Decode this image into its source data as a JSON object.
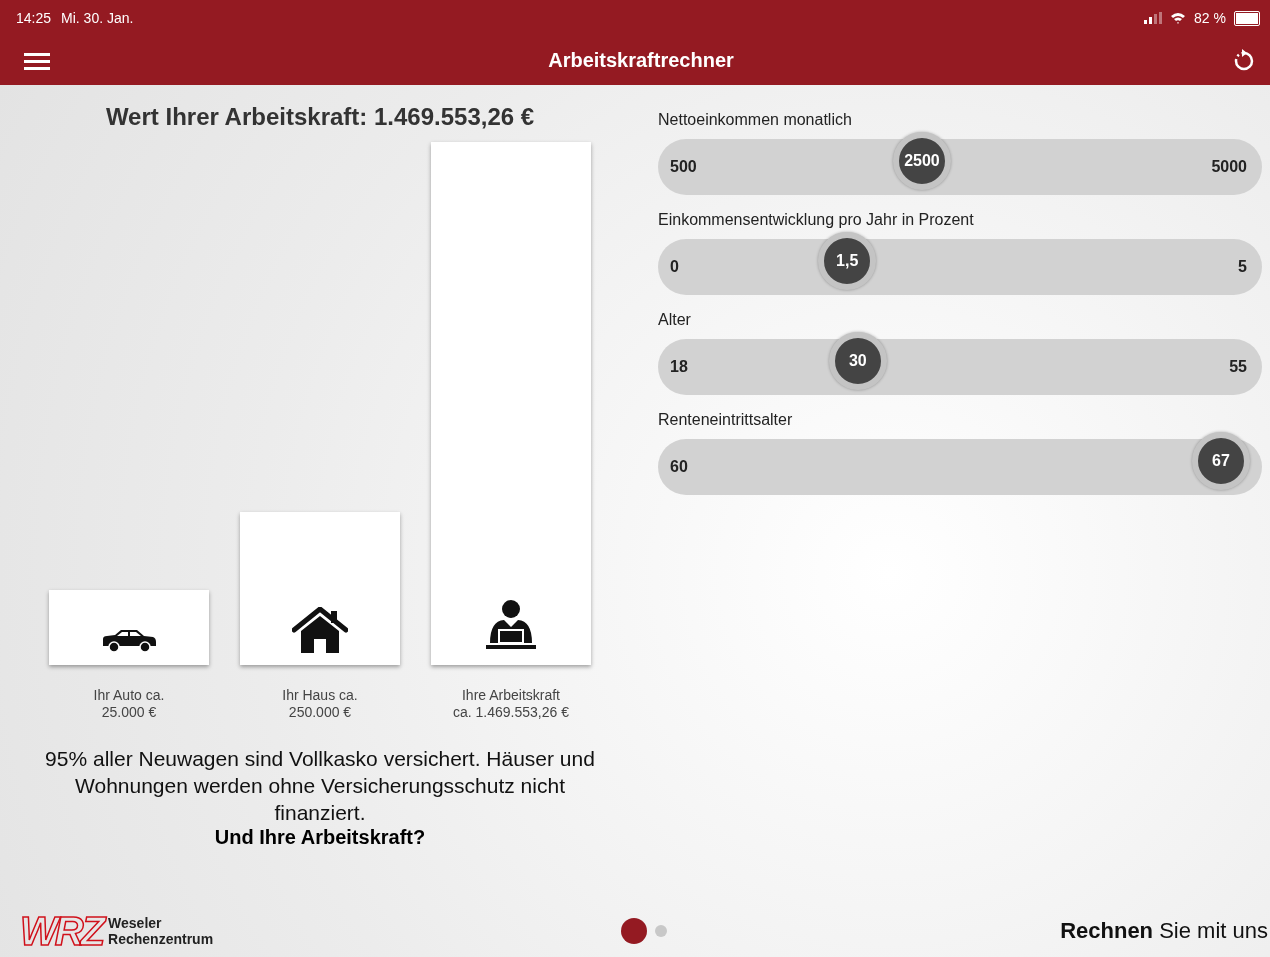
{
  "status_bar": {
    "time": "14:25",
    "date": "Mi. 30. Jan.",
    "battery": "82 %"
  },
  "header": {
    "title": "Arbeitskraftrechner"
  },
  "result": {
    "title": "Wert Ihrer Arbeitskraft: 1.469.553,26 €"
  },
  "bars": [
    {
      "kind": "car",
      "label": "Ihr Auto ca.",
      "value": "25.000 €"
    },
    {
      "kind": "house",
      "label": "Ihr Haus ca.",
      "value": "250.000 €"
    },
    {
      "kind": "worker",
      "label": "Ihre Arbeitskraft",
      "value": "ca. 1.469.553,26 €"
    }
  ],
  "message": {
    "text": "95% aller Neuwagen sind Vollkasko versichert. Häuser und Wohnungen werden ohne Versicherungsschutz nicht finanziert.",
    "question": "Und Ihre Arbeitskraft?"
  },
  "sliders": [
    {
      "label": "Nettoeinkommen monatlich",
      "min": "500",
      "max": "5000",
      "value": "2500",
      "level": 0.44
    },
    {
      "label": "Einkommensentwicklung pro Jahr in Prozent",
      "min": "0",
      "max": "5",
      "value": "1,5",
      "level": 0.3
    },
    {
      "label": "Alter",
      "min": "18",
      "max": "55",
      "value": "30",
      "level": 0.32
    },
    {
      "label": "Renteneintrittsalter",
      "min": "60",
      "value": "67",
      "level": 1.0
    }
  ],
  "footer": {
    "logo": "WRZ",
    "company_line_1": "Weseler",
    "company_line_2": "Rechenzentrum",
    "pages": [
      {
        "selected": true
      },
      {
        "selected": false
      }
    ],
    "tagline": "**Rechnen** Sie mit uns"
  }
}
